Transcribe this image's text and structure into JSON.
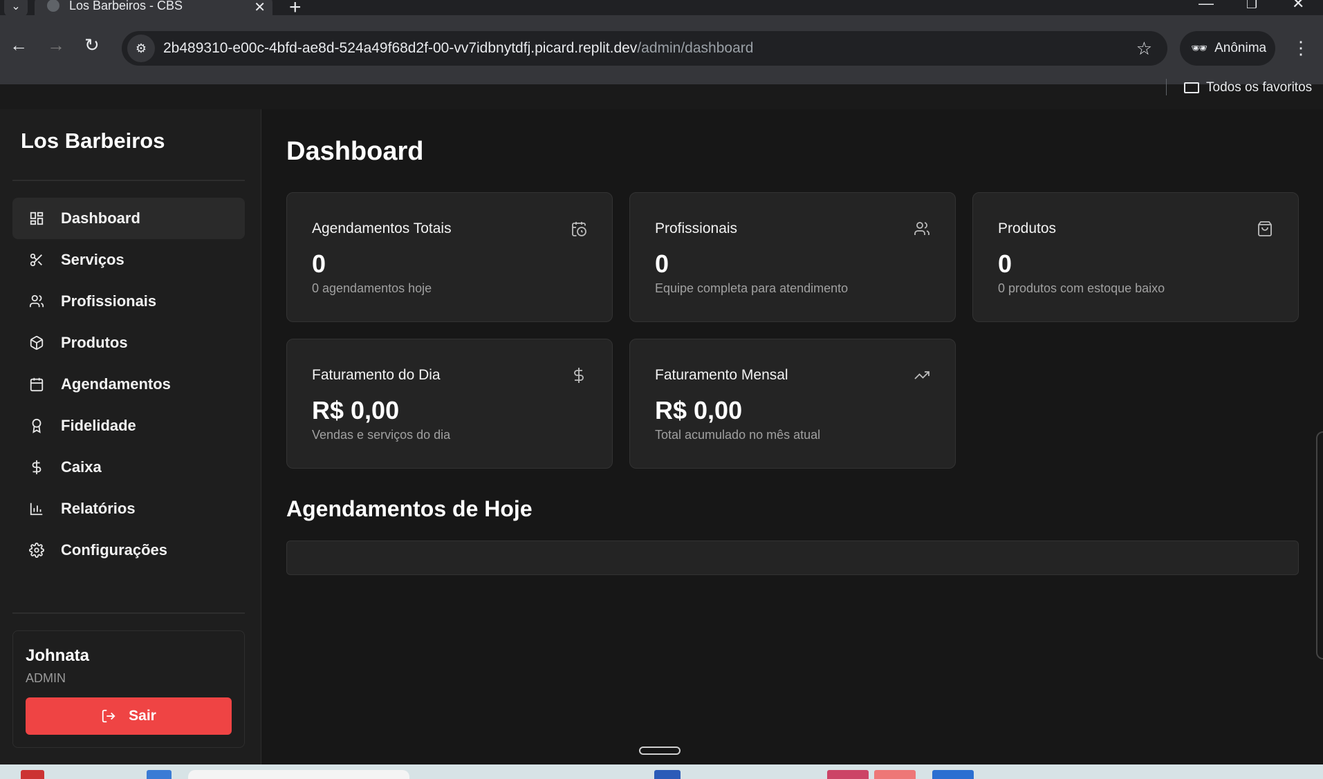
{
  "browser": {
    "tab_title": "Los Barbeiros - CBS",
    "url_main": "2b489310-e00c-4bfd-ae8d-524a49f68d2f-00-vv7idbnytdfj.picard.replit.dev",
    "url_path": "/admin/dashboard",
    "profile_label": "Anônima",
    "bookmarks_label": "Todos os favoritos"
  },
  "sidebar": {
    "brand": "Los Barbeiros",
    "items": [
      {
        "label": "Dashboard",
        "icon": "dashboard-grid-icon",
        "active": true
      },
      {
        "label": "Serviços",
        "icon": "scissors-icon"
      },
      {
        "label": "Profissionais",
        "icon": "users-icon"
      },
      {
        "label": "Produtos",
        "icon": "package-icon"
      },
      {
        "label": "Agendamentos",
        "icon": "calendar-icon"
      },
      {
        "label": "Fidelidade",
        "icon": "award-icon"
      },
      {
        "label": "Caixa",
        "icon": "dollar-icon"
      },
      {
        "label": "Relatórios",
        "icon": "bar-chart-icon"
      },
      {
        "label": "Configurações",
        "icon": "settings-icon"
      }
    ],
    "user": {
      "name": "Johnata",
      "role": "ADMIN",
      "logout_label": "Sair"
    }
  },
  "main": {
    "title": "Dashboard",
    "cards": [
      {
        "title": "Agendamentos Totais",
        "value": "0",
        "sub": "0 agendamentos hoje",
        "icon": "calendar-clock-icon"
      },
      {
        "title": "Profissionais",
        "value": "0",
        "sub": "Equipe completa para atendimento",
        "icon": "users-icon"
      },
      {
        "title": "Produtos",
        "value": "0",
        "sub": "0 produtos com estoque baixo",
        "icon": "shopping-bag-icon"
      },
      {
        "title": "Faturamento do Dia",
        "value": "R$ 0,00",
        "sub": "Vendas e serviços do dia",
        "icon": "dollar-icon"
      },
      {
        "title": "Faturamento Mensal",
        "value": "R$ 0,00",
        "sub": "Total acumulado no mês atual",
        "icon": "trending-up-icon"
      }
    ],
    "section_title": "Agendamentos de Hoje"
  },
  "colors": {
    "accent_danger": "#ef4444",
    "background": "#171717",
    "card": "#242424"
  }
}
